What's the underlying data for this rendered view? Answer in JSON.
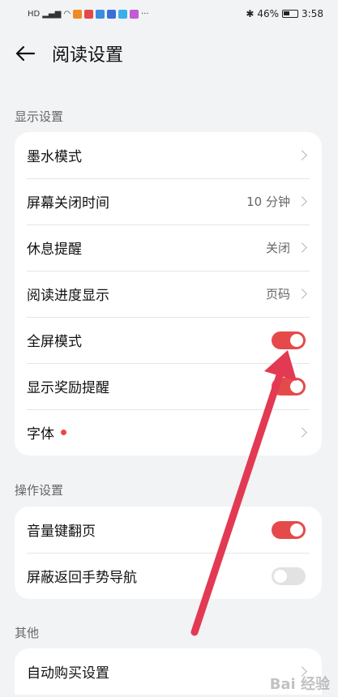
{
  "status_bar": {
    "left_icons": [
      "hd-icon",
      "signal-icon",
      "wifi-icon"
    ],
    "battery": "46%",
    "time": "3:58"
  },
  "header": {
    "title": "阅读设置"
  },
  "sections": [
    {
      "label": "显示设置",
      "rows": [
        {
          "label": "墨水模式",
          "type": "chevron"
        },
        {
          "label": "屏幕关闭时间",
          "type": "value",
          "value": "10 分钟"
        },
        {
          "label": "休息提醒",
          "type": "value",
          "value": "关闭"
        },
        {
          "label": "阅读进度显示",
          "type": "value",
          "value": "页码"
        },
        {
          "label": "全屏模式",
          "type": "toggle",
          "on": true
        },
        {
          "label": "显示奖励提醒",
          "type": "toggle",
          "on": true
        },
        {
          "label": "字体",
          "type": "chevron",
          "badge": true
        }
      ]
    },
    {
      "label": "操作设置",
      "rows": [
        {
          "label": "音量键翻页",
          "type": "toggle",
          "on": true
        },
        {
          "label": "屏蔽返回手势导航",
          "type": "toggle",
          "on": false
        }
      ]
    },
    {
      "label": "其他",
      "rows": [
        {
          "label": "自动购买设置",
          "type": "chevron"
        }
      ]
    }
  ],
  "colors": {
    "accent": "#e54a4a",
    "background": "#f1f3f5",
    "annotation_arrow": "#e23a52"
  },
  "watermark": "Bai 经验"
}
